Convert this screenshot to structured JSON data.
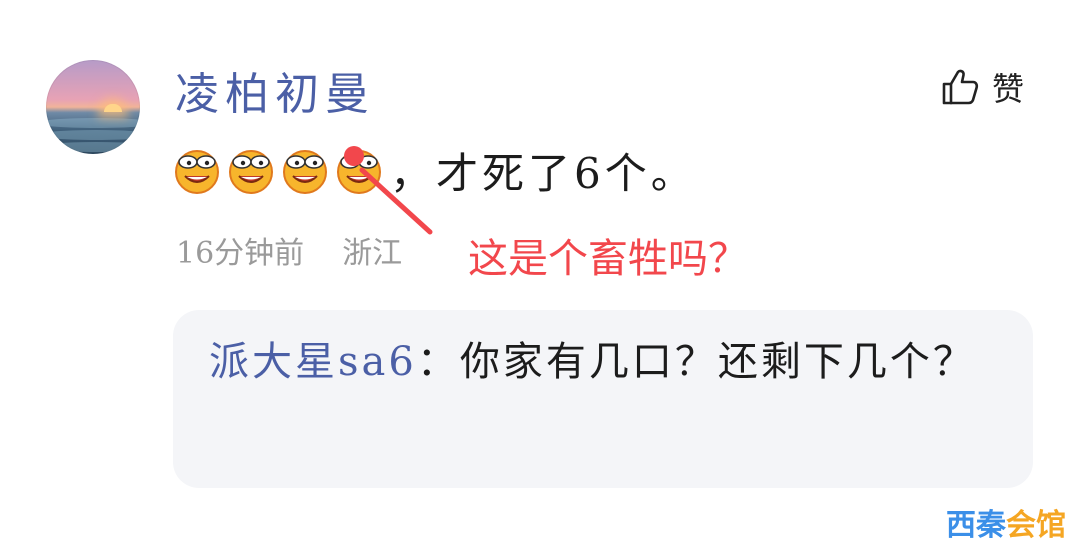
{
  "comment": {
    "username": "凌柏初曼",
    "like_label": "赞",
    "emoji_count": 4,
    "emoji_name": "smirk-emoji",
    "text": "，才死了6个。",
    "time": "16分钟前",
    "location": "浙江"
  },
  "annotation": {
    "text": "这是个畜牲吗？",
    "color": "#f2474c"
  },
  "reply": {
    "author": "派大星sa6",
    "separator": "：",
    "text": "你家有几口？还剩下几个？"
  },
  "watermark": {
    "chars": [
      "西",
      "秦",
      "会",
      "馆"
    ]
  },
  "colors": {
    "username": "#4b5fa6",
    "meta": "#9a9a9a",
    "reply_bg": "#f4f5f8"
  }
}
